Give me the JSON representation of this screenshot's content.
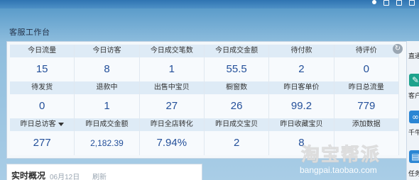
{
  "section_title": "客服工作台",
  "stats": [
    {
      "label": "今日流量",
      "value": "15"
    },
    {
      "label": "今日访客",
      "value": "8"
    },
    {
      "label": "今日成交笔数",
      "value": "1"
    },
    {
      "label": "今日成交金额",
      "value": "55.5"
    },
    {
      "label": "待付款",
      "value": "2"
    },
    {
      "label": "待评价",
      "value": "0"
    },
    {
      "label": "待发货",
      "value": "0"
    },
    {
      "label": "退款中",
      "value": "1"
    },
    {
      "label": "出售中宝贝",
      "value": "27"
    },
    {
      "label": "橱窗数",
      "value": "26"
    },
    {
      "label": "昨日客单价",
      "value": "99.2"
    },
    {
      "label": "昨日总流量",
      "value": "779"
    },
    {
      "label": "昨日总访客",
      "value": "277"
    },
    {
      "label": "昨日成交金额",
      "value": "2,182.39"
    },
    {
      "label": "昨日全店转化",
      "value": "7.94%"
    },
    {
      "label": "昨日成交宝贝",
      "value": "2"
    },
    {
      "label": "昨日收藏宝贝",
      "value": "8"
    },
    {
      "label": "添加数据",
      "value": ""
    }
  ],
  "right_rail": {
    "items": [
      "直通",
      "客户",
      "千牛",
      "任务"
    ]
  },
  "bottom_card": {
    "title": "实时概况",
    "date": "06月12日",
    "refresh": "刷新"
  },
  "watermark": {
    "text": "淘宝帮派",
    "url": "bangpai.taobao.com"
  },
  "colors": {
    "value_text": "#24509a",
    "label_bg": "#deebf6",
    "accent_teal": "#1ea38d",
    "accent_blue": "#2a86d4"
  }
}
